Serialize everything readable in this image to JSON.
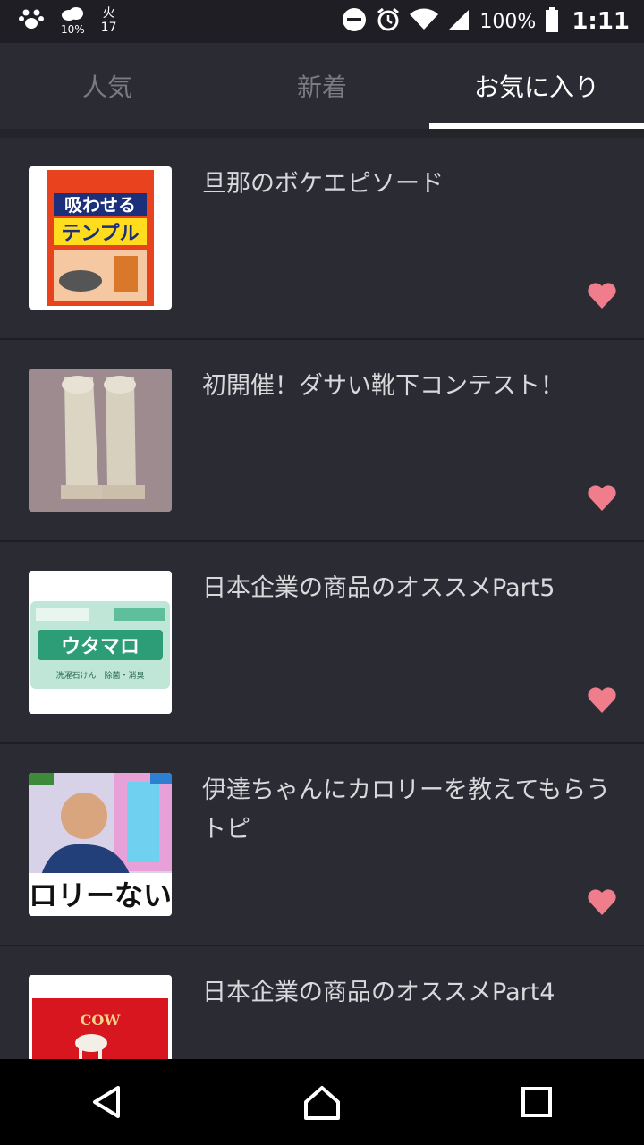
{
  "status_bar": {
    "weather_pct": "10%",
    "calendar_day": "火",
    "calendar_date": "17",
    "battery": "100%",
    "time": "1:11",
    "icons": [
      "paw-icon",
      "cloud-icon",
      "dnd-icon",
      "alarm-icon",
      "wifi-icon",
      "signal-icon",
      "battery-icon"
    ]
  },
  "tabs": [
    {
      "label": "人気"
    },
    {
      "label": "新着"
    },
    {
      "label": "お気に入り",
      "active": true
    }
  ],
  "items": [
    {
      "title": "旦那のボケエピソード",
      "favorite": true,
      "thumb": "insect-trap-package"
    },
    {
      "title": "初開催！ダサい靴下コンテスト！",
      "favorite": true,
      "thumb": "socks-photo"
    },
    {
      "title": "日本企業の商品のオススメPart5",
      "favorite": true,
      "thumb": "soap-bar-package"
    },
    {
      "title": "伊達ちゃんにカロリーを教えてもらうトピ",
      "favorite": true,
      "thumb": "tv-screenshot"
    },
    {
      "title": "日本企業の商品のオススメPart4",
      "favorite": true,
      "thumb": "red-soap-box"
    }
  ],
  "thumb_texts": {
    "trap_line1": "吸わせる",
    "trap_line2": "テンプル",
    "soap_brand": "ウタマロ",
    "soap_sub": "洗濯石けん　除菌・消臭",
    "tv_caption": "ロリーない",
    "box_brand": "COW"
  },
  "colors": {
    "background": "#2b2b33",
    "heart": "#f07d8c",
    "active_tab": "#ffffff",
    "inactive_tab": "#7a7a80"
  }
}
